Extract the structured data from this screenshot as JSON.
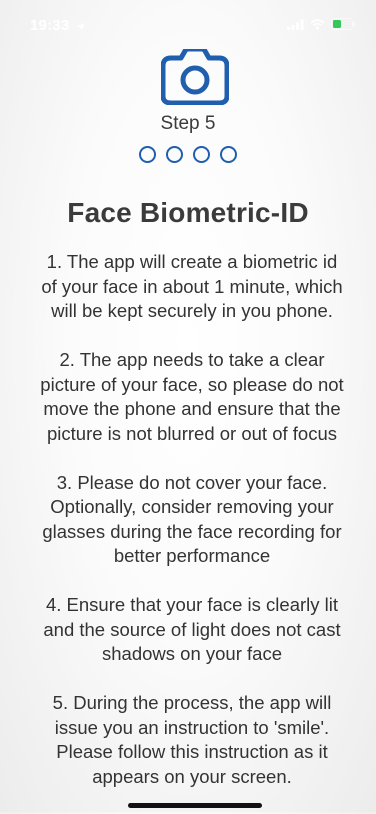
{
  "status_bar": {
    "time": "19:33",
    "icons": [
      "location-arrow-icon",
      "signal-icon",
      "wifi-icon",
      "battery-icon"
    ],
    "battery_color": "#34c759"
  },
  "header": {
    "icon": "camera-icon",
    "accent_color": "#1f5fae",
    "step_label": "Step 5",
    "step_dots": 4
  },
  "title": "Face Biometric-ID",
  "instructions": [
    "1. The app will create a biometric id of your face in about 1 minute, which will be kept securely in you phone.",
    "2. The app needs to take a clear picture of your face, so please do not move the phone and ensure that the picture is not blurred or out of focus",
    "3. Please do not cover your face. Optionally, consider removing your glasses during the face recording for better performance",
    "4. Ensure that your face is clearly lit and the source of light does not cast shadows on your face",
    "5. During the process, the app will issue you an instruction to 'smile'. Please follow this instruction as it appears on your screen."
  ]
}
